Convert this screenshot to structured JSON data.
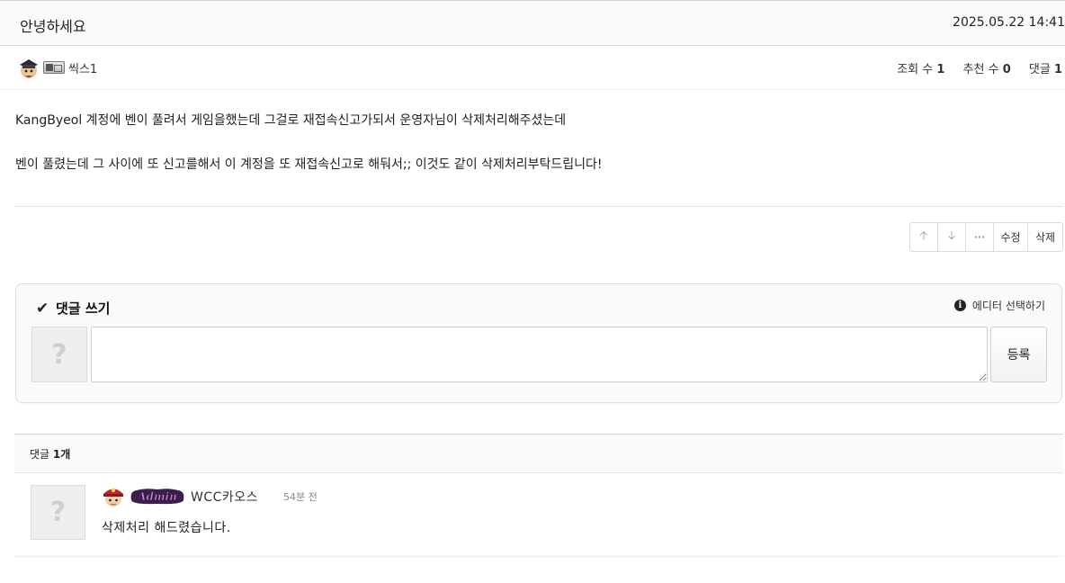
{
  "post": {
    "title": "안녕하세요",
    "date": "2025.05.22 14:41",
    "author": "씩스1",
    "stats": {
      "views_label": "조회 수",
      "views": "1",
      "recommend_label": "추천 수",
      "recommend": "0",
      "comments_label": "댓글",
      "comments": "1"
    },
    "body": [
      "KangByeol 계정에 벤이 풀려서 게임을했는데 그걸로 재접속신고가되서 운영자님이 삭제처리해주셨는데",
      "벤이 풀렸는데 그 사이에 또 신고를해서 이 계정을 또 재접속신고로 해둬서;; 이것도 같이 삭제처리부탁드립니다!"
    ]
  },
  "actions": {
    "upvote_icon": "🡡",
    "downvote_icon": "🡣",
    "more_icon": "···",
    "edit_label": "수정",
    "delete_label": "삭제"
  },
  "comment_form": {
    "check_icon": "✔",
    "title": "댓글 쓰기",
    "editor_info_icon": "i",
    "editor_label": "에디터 선택하기",
    "avatar_placeholder": "?",
    "textarea_value": "",
    "submit_label": "등록"
  },
  "comment_list": {
    "count_label": "댓글",
    "count_value": "1개",
    "items": [
      {
        "avatar_placeholder": "?",
        "admin_badge": "Admin",
        "name": "WCC카오스",
        "time": "54분 전",
        "text": "삭제처리 해드렸습니다."
      }
    ]
  },
  "colors": {
    "header_bg": "#fafafa",
    "border": "#d6d6d6",
    "admin_badge_text": "#c78ad9",
    "admin_badge_outline": "#3a1f4a"
  }
}
